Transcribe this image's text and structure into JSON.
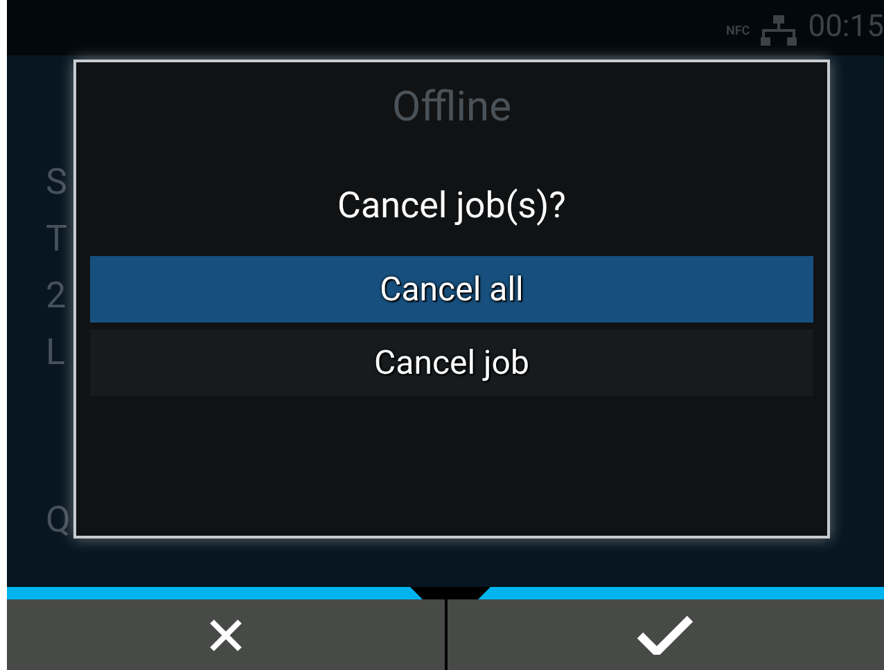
{
  "status_bar": {
    "nfc": "NFC",
    "time": "00:15"
  },
  "background": {
    "title": "Offline",
    "labels": [
      "S",
      "T",
      "2",
      "L",
      "Q"
    ]
  },
  "dialog": {
    "title": "Cancel job(s)?",
    "options": [
      {
        "label": "Cancel all",
        "selected": true
      },
      {
        "label": "Cancel job",
        "selected": false
      }
    ]
  },
  "buttons": [
    {
      "kind": "cancel"
    },
    {
      "kind": "confirm"
    }
  ]
}
